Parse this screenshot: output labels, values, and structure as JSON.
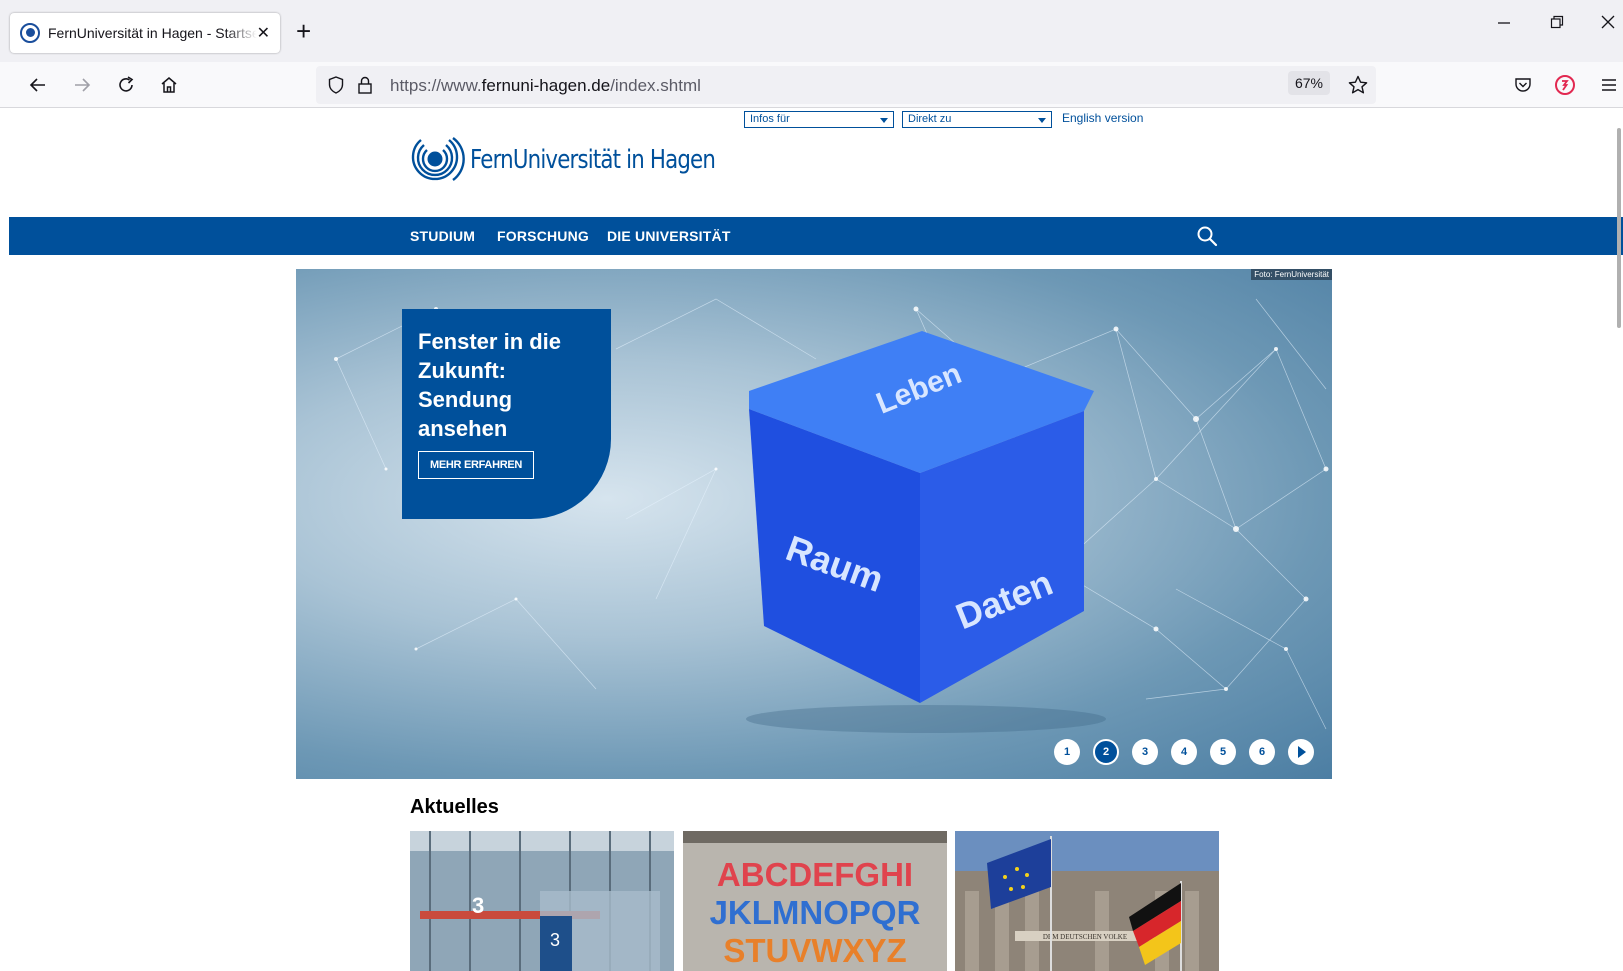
{
  "browser": {
    "tab_title": "FernUniversität in Hagen - Startseite",
    "tab_close": "✕",
    "new_tab": "+",
    "url_prefix": "https://www.",
    "url_domain": "fernuni-hagen.de",
    "url_path": "/index.shtml",
    "zoom": "67%"
  },
  "header": {
    "infos_select": "Infos für",
    "direkt_select": "Direkt zu",
    "english_link": "English version",
    "logo_text": "FernUniversität in Hagen"
  },
  "mainnav": {
    "items": [
      {
        "label": "STUDIUM"
      },
      {
        "label": "FORSCHUNG"
      },
      {
        "label": "DIE UNIVERSITÄT"
      }
    ]
  },
  "hero": {
    "photo_credit": "Foto: FernUniversität",
    "teaser_title": "Fenster in die Zukunft: Sendung ansehen",
    "teaser_button": "MEHR ERFAHREN",
    "cube_labels": {
      "top": "Leben",
      "left": "Raum",
      "right": "Daten"
    },
    "slides": [
      {
        "label": "1"
      },
      {
        "label": "2"
      },
      {
        "label": "3"
      },
      {
        "label": "4"
      },
      {
        "label": "5"
      },
      {
        "label": "6"
      }
    ],
    "active_slide": "2"
  },
  "news": {
    "title": "Aktuelles",
    "card2_letters": [
      "ABCDEFGHI",
      "JKLMNOPQR",
      "STUVWXYZ"
    ],
    "card3_text": "DEM DEUTSCHEN VOLKE"
  },
  "colors": {
    "brand_blue": "#00509b"
  }
}
